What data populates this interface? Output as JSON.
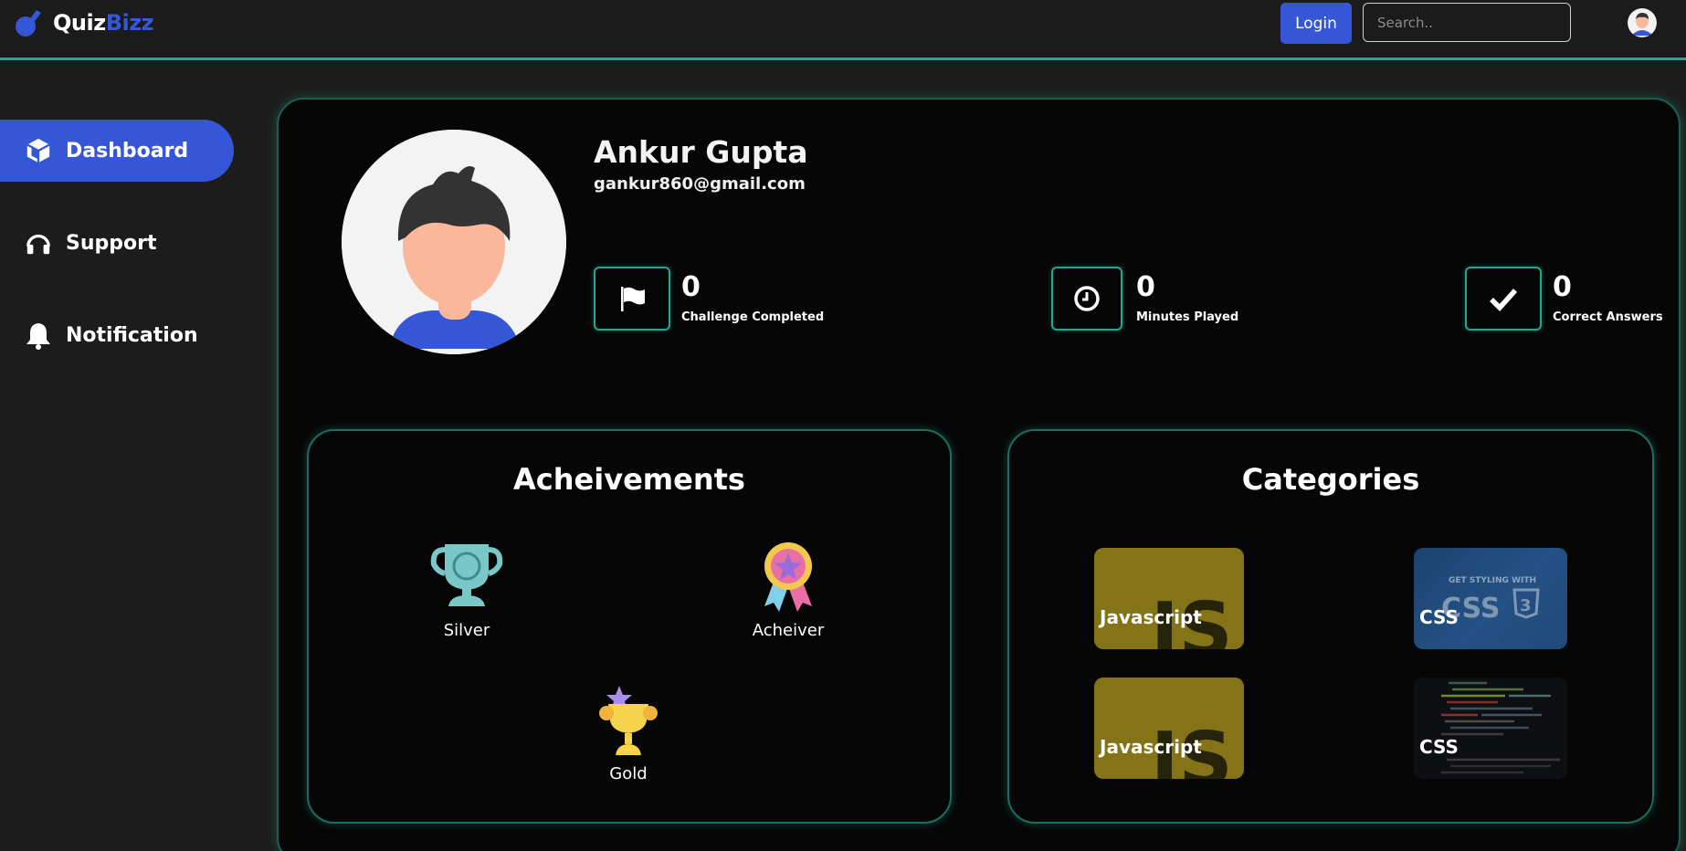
{
  "header": {
    "logo_part1": "Quiz",
    "logo_part2": "Bizz",
    "login_label": "Login",
    "search_placeholder": "Search.."
  },
  "sidebar": {
    "items": [
      {
        "label": "Dashboard",
        "icon": "cube-icon",
        "active": true
      },
      {
        "label": "Support",
        "icon": "headphones-icon",
        "active": false
      },
      {
        "label": "Notification",
        "icon": "bell-icon",
        "active": false
      }
    ]
  },
  "profile": {
    "name": "Ankur Gupta",
    "email": "gankur860@gmail.com"
  },
  "stats": [
    {
      "value": "0",
      "label": "Challenge Completed",
      "icon": "flag-icon"
    },
    {
      "value": "0",
      "label": "Minutes Played",
      "icon": "clock-icon"
    },
    {
      "value": "0",
      "label": "Correct Answers",
      "icon": "check-icon"
    }
  ],
  "achievements": {
    "title": "Acheivements",
    "items": [
      {
        "label": "Silver",
        "icon": "trophy-icon"
      },
      {
        "label": "Acheiver",
        "icon": "medal-icon"
      },
      {
        "label": "Gold",
        "icon": "gold-trophy-icon"
      }
    ]
  },
  "categories": {
    "title": "Categories",
    "items": [
      {
        "label": "Javascript",
        "thumb": "js-logo"
      },
      {
        "label": "CSS",
        "thumb": "css-banner",
        "thumb_text": "GET STYLING WITH"
      },
      {
        "label": "Javascript",
        "thumb": "js-logo"
      },
      {
        "label": "CSS",
        "thumb": "code-screenshot"
      }
    ]
  },
  "colors": {
    "accent": "#3556d6",
    "teal": "#1fa896",
    "js_yellow": "#847417",
    "css_blue": "#1e4c7e"
  }
}
